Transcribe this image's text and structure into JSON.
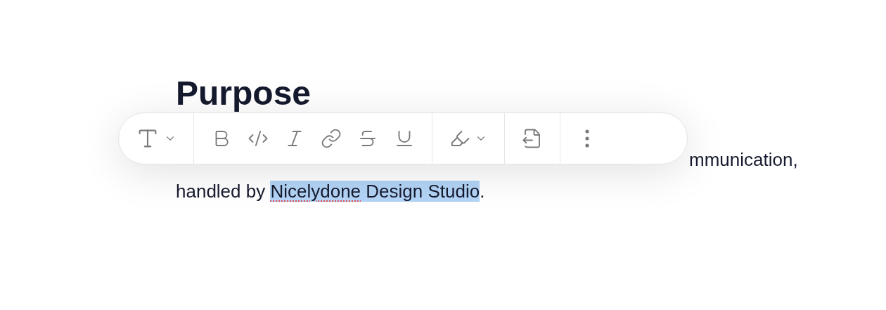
{
  "heading": "Purpose",
  "paragraph_lines": [
    [
      {
        "text": "mmunication,",
        "selected": false,
        "misspelled": false
      }
    ],
    [
      {
        "text": "handled by ",
        "selected": false,
        "misspelled": false
      },
      {
        "text": "Nicelydone",
        "selected": true,
        "misspelled": true
      },
      {
        "text": " Design Studio",
        "selected": true,
        "misspelled": false
      },
      {
        "text": ".",
        "selected": false,
        "misspelled": false
      }
    ]
  ],
  "toolbar": {
    "groups": [
      {
        "buttons": [
          {
            "kind": "text-style",
            "dropdown": true
          }
        ]
      },
      {
        "buttons": [
          {
            "kind": "bold",
            "dropdown": false
          },
          {
            "kind": "code",
            "dropdown": false
          },
          {
            "kind": "italic",
            "dropdown": false
          },
          {
            "kind": "link",
            "dropdown": false
          },
          {
            "kind": "strikethrough",
            "dropdown": false
          },
          {
            "kind": "underline",
            "dropdown": false
          }
        ]
      },
      {
        "buttons": [
          {
            "kind": "highlight",
            "dropdown": true
          }
        ]
      },
      {
        "buttons": [
          {
            "kind": "export",
            "dropdown": false
          }
        ]
      },
      {
        "buttons": [
          {
            "kind": "more",
            "dropdown": false
          }
        ]
      }
    ]
  }
}
